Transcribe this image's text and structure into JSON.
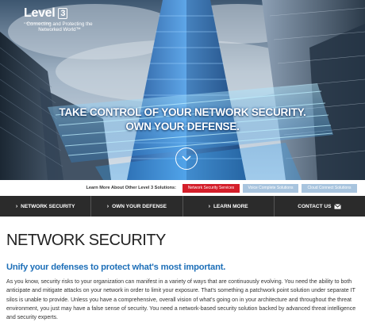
{
  "brand": {
    "logo_word": "Level",
    "logo_num": "3",
    "logo_sub": "COMMUNICATIONS",
    "tagline": "Connecting and Protecting the Networked World™"
  },
  "hero": {
    "headline_line1": "TAKE CONTROL OF YOUR NETWORK SECURITY.",
    "headline_line2": "OWN YOUR DEFENSE."
  },
  "solutions": {
    "label": "Learn More About Other Level 3 Solutions:",
    "buttons": [
      {
        "label": "Network Security Services"
      },
      {
        "label": "Voice Complete Solutions"
      },
      {
        "label": "Cloud Connect Solutions"
      }
    ]
  },
  "nav": {
    "items": [
      {
        "label": "NETWORK SECURITY"
      },
      {
        "label": "OWN YOUR DEFENSE"
      },
      {
        "label": "LEARN MORE"
      },
      {
        "label": "CONTACT US"
      }
    ]
  },
  "content": {
    "title": "NETWORK SECURITY",
    "subhead": "Unify your defenses to protect what's most important.",
    "body": "As you know, security risks to your organization can manifest in a variety of ways that are continuously evolving. You need the ability to both anticipate and mitigate attacks on your network in order to limit your exposure. That's something a patchwork point solution under separate IT silos is unable to provide. Unless you have a comprehensive, overall vision of what's going on in your architecture and throughout the threat environment, you just may have a false sense of security. You need a network-based security solution backed by advanced threat intelligence and security experts."
  },
  "colors": {
    "accent_red": "#d41e2a",
    "accent_blue": "#1d6fb8",
    "nav_bg": "#2b2b2b",
    "chip_blue": "#a8c4de"
  },
  "icons": {
    "scroll_down": "chevron-down-icon",
    "nav_chevron": "chevron-right-icon",
    "contact": "envelope-icon"
  }
}
